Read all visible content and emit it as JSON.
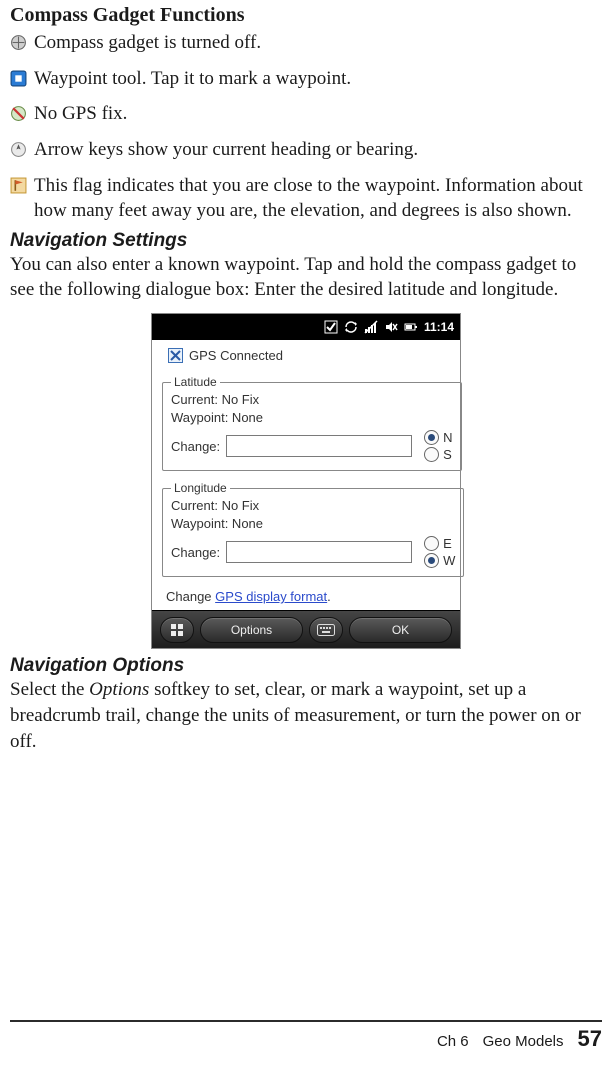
{
  "heading": "Compass Gadget Functions",
  "functions": {
    "off": "Compass gadget is turned off.",
    "waypoint": "Waypoint tool. Tap it to mark a waypoint.",
    "nogps": "No GPS fix.",
    "arrow": "Arrow keys show your current heading or bearing.",
    "flag": "This flag indicates that you are close to the waypoint. Information about how many feet away you are, the elevation, and degrees is also shown."
  },
  "nav_settings": {
    "heading": "Navigation Settings",
    "body": "You can also enter a known waypoint. Tap and hold the compass gadget to see the following dialogue box: Enter the desired latitude and longitude."
  },
  "device": {
    "time": "11:14",
    "gps_connected_label": "GPS Connected",
    "latitude": {
      "legend": "Latitude",
      "current": "Current: No Fix",
      "waypoint": "Waypoint: None",
      "change_label": "Change:",
      "value": "",
      "opts": {
        "n": "N",
        "s": "S"
      },
      "selected": "N"
    },
    "longitude": {
      "legend": "Longitude",
      "current": "Current: No Fix",
      "waypoint": "Waypoint: None",
      "change_label": "Change:",
      "value": "",
      "opts": {
        "e": "E",
        "w": "W"
      },
      "selected": "W"
    },
    "change_format_prefix": "Change ",
    "change_format_link": "GPS display format",
    "change_format_suffix": ".",
    "softkeys": {
      "options": "Options",
      "ok": "OK"
    }
  },
  "nav_options": {
    "heading": "Navigation Options",
    "prefix": "Select the ",
    "italic": "Options",
    "suffix": " softkey to set, clear, or mark a waypoint, set up a breadcrumb trail, change the units of measurement, or turn the power on or off."
  },
  "footer": {
    "chapter": "Ch 6",
    "title": "Geo Models",
    "page": "57"
  }
}
